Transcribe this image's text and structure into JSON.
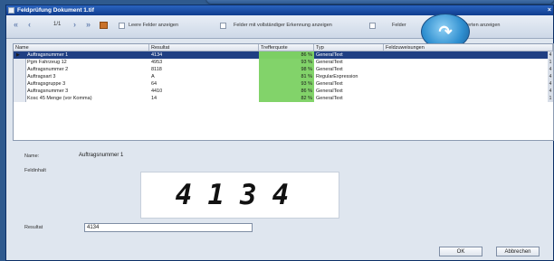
{
  "window": {
    "title": "Feldprüfung Dokument 1.tif",
    "close_glyph": "×"
  },
  "toolbar": {
    "first_glyph": "«",
    "prev_glyph": "‹",
    "page_indicator": "1/1",
    "next_glyph": "›",
    "last_glyph": "»",
    "option1_label": "Leere Felder anzeigen",
    "option2_label": "Felder mit vollständiger Erkennung anzeigen",
    "option3_label": "Felder",
    "option4_label": "Werten anzeigen",
    "round_button_glyph": "↷"
  },
  "grid": {
    "columns": [
      "Name",
      "Resultat",
      "Trefferquote",
      "Typ",
      "Feldzuweisungen"
    ],
    "rows": [
      {
        "name": "Auftragsnummer 1",
        "resultat": "4134",
        "quote": "86 %",
        "typ": "GeneralText",
        "end": "4",
        "selected": true
      },
      {
        "name": "Pgm Fahrzeug 12",
        "resultat": "4953",
        "quote": "93 %",
        "typ": "GeneralText",
        "end": "1",
        "selected": false
      },
      {
        "name": "Auftragsnummer 2",
        "resultat": "8118",
        "quote": "98 %",
        "typ": "GeneralText",
        "end": "4",
        "selected": false
      },
      {
        "name": "Auftragsart 3",
        "resultat": "A",
        "quote": "81 %",
        "typ": "RegularExpression",
        "end": "4",
        "selected": false
      },
      {
        "name": "Auftragsgruppe 3",
        "resultat": "64",
        "quote": "93 %",
        "typ": "GeneralText",
        "end": "4",
        "selected": false
      },
      {
        "name": "Auftragsnummer 3",
        "resultat": "4410",
        "quote": "86 %",
        "typ": "GeneralText",
        "end": "4",
        "selected": false
      },
      {
        "name": "Kosc 45 Menge (vor Komma)",
        "resultat": "14",
        "quote": "82 %",
        "typ": "GeneralText",
        "end": "1",
        "selected": false
      }
    ]
  },
  "detail": {
    "name_label": "Name:",
    "name_value": "Auftragsnummer 1",
    "feldinhalt_label": "Feldinhalt",
    "handwriting": "4134",
    "resultat_label": "Resultat",
    "resultat_value": "4134"
  },
  "buttons": {
    "ok": "OK",
    "cancel": "Abbrechen"
  },
  "colors": {
    "selection": "#1f3f83",
    "quote_fill": "#82d36a",
    "titlebar": "#1e4fa6"
  }
}
